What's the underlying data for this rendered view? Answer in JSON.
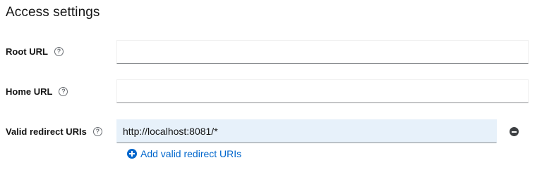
{
  "section": {
    "title": "Access settings"
  },
  "fields": {
    "root_url": {
      "label": "Root URL",
      "value": "",
      "help": "?"
    },
    "home_url": {
      "label": "Home URL",
      "value": "",
      "help": "?"
    },
    "redirect_uris": {
      "label": "Valid redirect URIs",
      "value": "http://localhost:8081/*",
      "help": "?"
    }
  },
  "add_redirect": {
    "label": "Add valid redirect URIs"
  },
  "colors": {
    "link": "#0066cc",
    "filled_input_bg": "#e7f1fa",
    "input_border": "#8a8d90"
  },
  "icons": {
    "help": "question-circle-icon",
    "remove": "minus-circle-icon",
    "add": "plus-circle-icon"
  }
}
